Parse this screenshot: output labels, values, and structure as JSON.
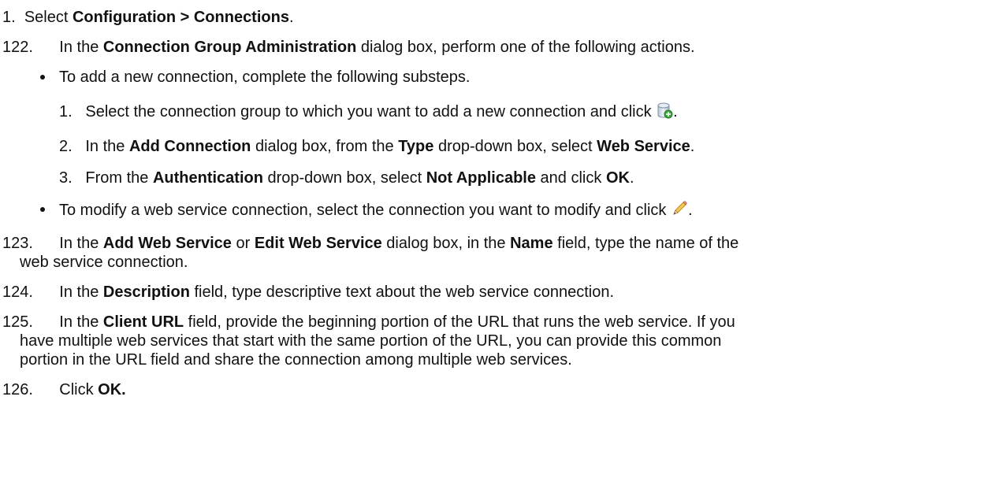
{
  "steps": {
    "s1": {
      "num": "1.",
      "pre": "Select ",
      "b1": "Configuration > Connections",
      "post": "."
    },
    "s122": {
      "num": "122.",
      "pre": "In the ",
      "b1": "Connection Group Administration",
      "post": " dialog box, perform one of the following actions."
    },
    "bullet1": {
      "text": "To add a new connection, complete the following substeps."
    },
    "sub1": {
      "num": "1.",
      "pre": "Select the connection group to which you want to add a new connection and click ",
      "post": ".",
      "icon": "add-connection-icon"
    },
    "sub2": {
      "num": "2.",
      "pre": "In the ",
      "b1": "Add Connection",
      "mid1": " dialog box, from the ",
      "b2": "Type",
      "mid2": " drop-down box, select ",
      "b3": "Web Service",
      "post": "."
    },
    "sub3": {
      "num": "3.",
      "pre": "From the ",
      "b1": "Authentication",
      "mid1": " drop-down box, select ",
      "b2": "Not Applicable",
      "mid2": " and click ",
      "b3": "OK",
      "post": "."
    },
    "bullet2": {
      "text": "To modify a web service connection, select the connection you want to modify and click ",
      "post": ".",
      "icon": "pencil-edit-icon"
    },
    "s123": {
      "num": "123.",
      "pre": "In the ",
      "b1": "Add Web Service",
      "mid1": " or ",
      "b2": "Edit Web Service",
      "mid2": " dialog box, in the ",
      "b3": "Name",
      "post": " field, type the name of the",
      "line2": "web service connection."
    },
    "s124": {
      "num": "124.",
      "pre": "In the ",
      "b1": "Description",
      "post": " field, type descriptive text about the web service connection."
    },
    "s125": {
      "num": "125.",
      "pre": "In the ",
      "b1": "Client URL",
      "post": " field, provide the beginning portion of the URL that runs the web service. If you",
      "line2": "have multiple web services that start with the same portion of the URL, you can provide this common",
      "line3": "portion in the URL field and share the connection among multiple web services."
    },
    "s126": {
      "num": "126.",
      "pre": "Click ",
      "b1": "OK."
    }
  }
}
